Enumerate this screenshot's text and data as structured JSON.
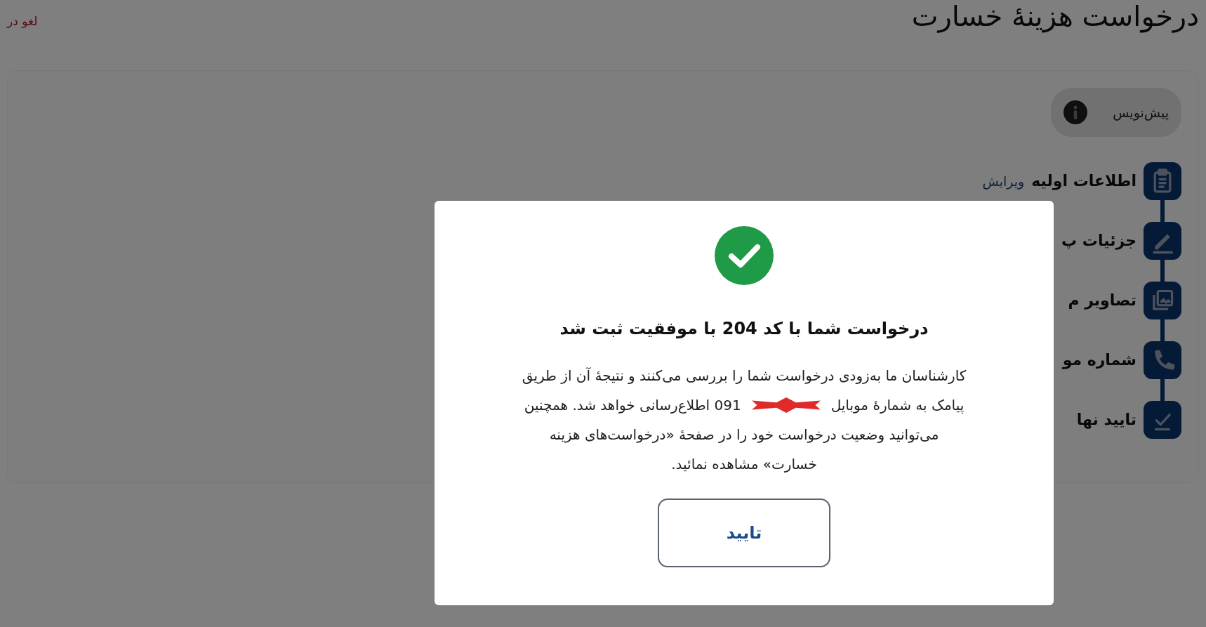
{
  "page": {
    "title": "درخواست هزینهٔ خسارت",
    "cancel_link": "لغو در"
  },
  "status_pill": {
    "label": "پیش‌نویس"
  },
  "steps": [
    {
      "kind": "clipboard",
      "label": "اطلاعات اولیه",
      "edit_link": "ویرایش"
    },
    {
      "kind": "pencil",
      "label": "جزئیات پ"
    },
    {
      "kind": "images",
      "label": "تصاویر م"
    },
    {
      "kind": "phone",
      "label": "شماره مو"
    },
    {
      "kind": "check",
      "label": "تایید نها"
    }
  ],
  "modal": {
    "heading": "درخواست شما با کد 204 با موفقیت ثبت شد",
    "message_first": "کارشناسان ما به‌زودی درخواست شما را بررسی می‌کنند و نتیجهٔ آن از طریق",
    "message_before": "پیامک به شمارهٔ موبایل",
    "message_after": "091 اطلاع‌رسانی خواهد شد. همچنین",
    "message_rest": "می‌توانید وضعیت درخواست خود را در صفحهٔ «درخواست‌های هزینه خسارت» مشاهده نمائید.",
    "confirm_button": "تایید"
  }
}
